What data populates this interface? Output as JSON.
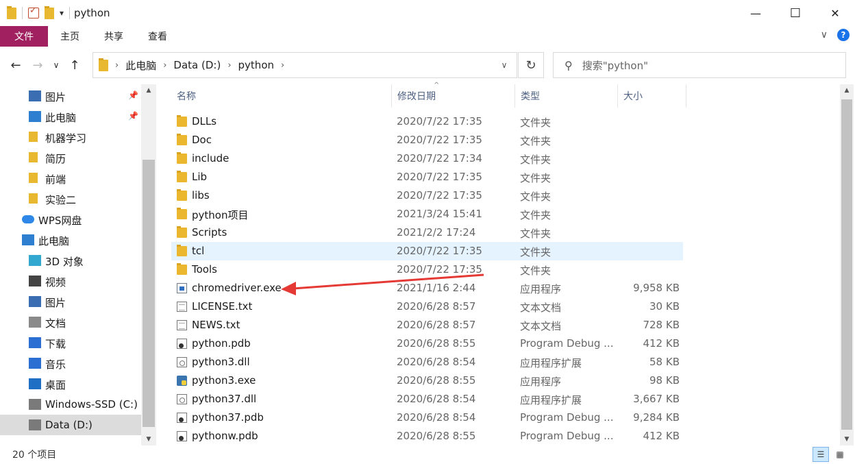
{
  "window": {
    "title": "python",
    "minimize_glyph": "—",
    "maximize_glyph": "☐",
    "close_glyph": "✕",
    "qa_dropdown_glyph": "▾"
  },
  "ribbon": {
    "file_tab": "文件",
    "tabs": [
      "主页",
      "共享",
      "查看"
    ],
    "expand_glyph": "∨",
    "help_glyph": "?"
  },
  "nav": {
    "back": "←",
    "forward": "→",
    "recent": "∨",
    "up": "↑"
  },
  "address": {
    "crumbs": [
      "此电脑",
      "Data (D:)",
      "python"
    ],
    "sep": "›",
    "dropdown": "∨",
    "refresh": "↻"
  },
  "search": {
    "icon": "⚲",
    "placeholder": "搜索\"python\""
  },
  "navpane": {
    "items": [
      {
        "label": "图片",
        "icon": "pictures-icon",
        "pinned": true
      },
      {
        "label": "此电脑",
        "icon": "this-pc-icon",
        "pinned": true
      },
      {
        "label": "机器学习",
        "icon": "folder-icon",
        "pinned": false
      },
      {
        "label": "简历",
        "icon": "folder-icon",
        "pinned": false
      },
      {
        "label": "前端",
        "icon": "folder-icon",
        "pinned": false
      },
      {
        "label": "实验二",
        "icon": "folder-icon",
        "pinned": false
      },
      {
        "label": "WPS网盘",
        "icon": "cloud-icon",
        "pinned": false
      },
      {
        "label": "此电脑",
        "icon": "this-pc-icon",
        "pinned": false
      },
      {
        "label": "3D 对象",
        "icon": "3d-objects-icon",
        "pinned": false
      },
      {
        "label": "视频",
        "icon": "video-icon",
        "pinned": false
      },
      {
        "label": "图片",
        "icon": "pictures-icon",
        "pinned": false
      },
      {
        "label": "文档",
        "icon": "documents-icon",
        "pinned": false
      },
      {
        "label": "下载",
        "icon": "download-icon",
        "pinned": false
      },
      {
        "label": "音乐",
        "icon": "music-icon",
        "pinned": false
      },
      {
        "label": "桌面",
        "icon": "desktop-icon",
        "pinned": false
      },
      {
        "label": "Windows-SSD (C:)",
        "icon": "drive-icon",
        "pinned": false
      },
      {
        "label": "Data (D:)",
        "icon": "drive-icon",
        "pinned": false
      }
    ],
    "pin_glyph": "📌"
  },
  "columns": {
    "name": "名称",
    "date": "修改日期",
    "type": "类型",
    "size": "大小",
    "sort_glyph": "^"
  },
  "files": [
    {
      "name": "DLLs",
      "date": "2020/7/22 17:35",
      "type": "文件夹",
      "size": "",
      "icon": "folder"
    },
    {
      "name": "Doc",
      "date": "2020/7/22 17:35",
      "type": "文件夹",
      "size": "",
      "icon": "folder"
    },
    {
      "name": "include",
      "date": "2020/7/22 17:34",
      "type": "文件夹",
      "size": "",
      "icon": "folder"
    },
    {
      "name": "Lib",
      "date": "2020/7/22 17:35",
      "type": "文件夹",
      "size": "",
      "icon": "folder"
    },
    {
      "name": "libs",
      "date": "2020/7/22 17:35",
      "type": "文件夹",
      "size": "",
      "icon": "folder"
    },
    {
      "name": "python项目",
      "date": "2021/3/24 15:41",
      "type": "文件夹",
      "size": "",
      "icon": "folder"
    },
    {
      "name": "Scripts",
      "date": "2021/2/2 17:24",
      "type": "文件夹",
      "size": "",
      "icon": "folder"
    },
    {
      "name": "tcl",
      "date": "2020/7/22 17:35",
      "type": "文件夹",
      "size": "",
      "icon": "folder"
    },
    {
      "name": "Tools",
      "date": "2020/7/22 17:35",
      "type": "文件夹",
      "size": "",
      "icon": "folder"
    },
    {
      "name": "chromedriver.exe",
      "date": "2021/1/16 2:44",
      "type": "应用程序",
      "size": "9,958 KB",
      "icon": "exe"
    },
    {
      "name": "LICENSE.txt",
      "date": "2020/6/28 8:57",
      "type": "文本文档",
      "size": "30 KB",
      "icon": "txt"
    },
    {
      "name": "NEWS.txt",
      "date": "2020/6/28 8:57",
      "type": "文本文档",
      "size": "728 KB",
      "icon": "txt"
    },
    {
      "name": "python.pdb",
      "date": "2020/6/28 8:55",
      "type": "Program Debug ...",
      "size": "412 KB",
      "icon": "pdb"
    },
    {
      "name": "python3.dll",
      "date": "2020/6/28 8:54",
      "type": "应用程序扩展",
      "size": "58 KB",
      "icon": "dll"
    },
    {
      "name": "python3.exe",
      "date": "2020/6/28 8:55",
      "type": "应用程序",
      "size": "98 KB",
      "icon": "py"
    },
    {
      "name": "python37.dll",
      "date": "2020/6/28 8:54",
      "type": "应用程序扩展",
      "size": "3,667 KB",
      "icon": "dll"
    },
    {
      "name": "python37.pdb",
      "date": "2020/6/28 8:54",
      "type": "Program Debug ...",
      "size": "9,284 KB",
      "icon": "pdb"
    },
    {
      "name": "pythonw.pdb",
      "date": "2020/6/28 8:55",
      "type": "Program Debug ...",
      "size": "412 KB",
      "icon": "pdb"
    }
  ],
  "hovered_row": 7,
  "status": {
    "count": "20 个项目",
    "details_view": "☰",
    "icons_view": "▦"
  },
  "colors": {
    "file_tab": "#a02060",
    "annotation_arrow": "#e53935",
    "row_hover": "#e5f3ff",
    "header_text": "#4d6082"
  }
}
